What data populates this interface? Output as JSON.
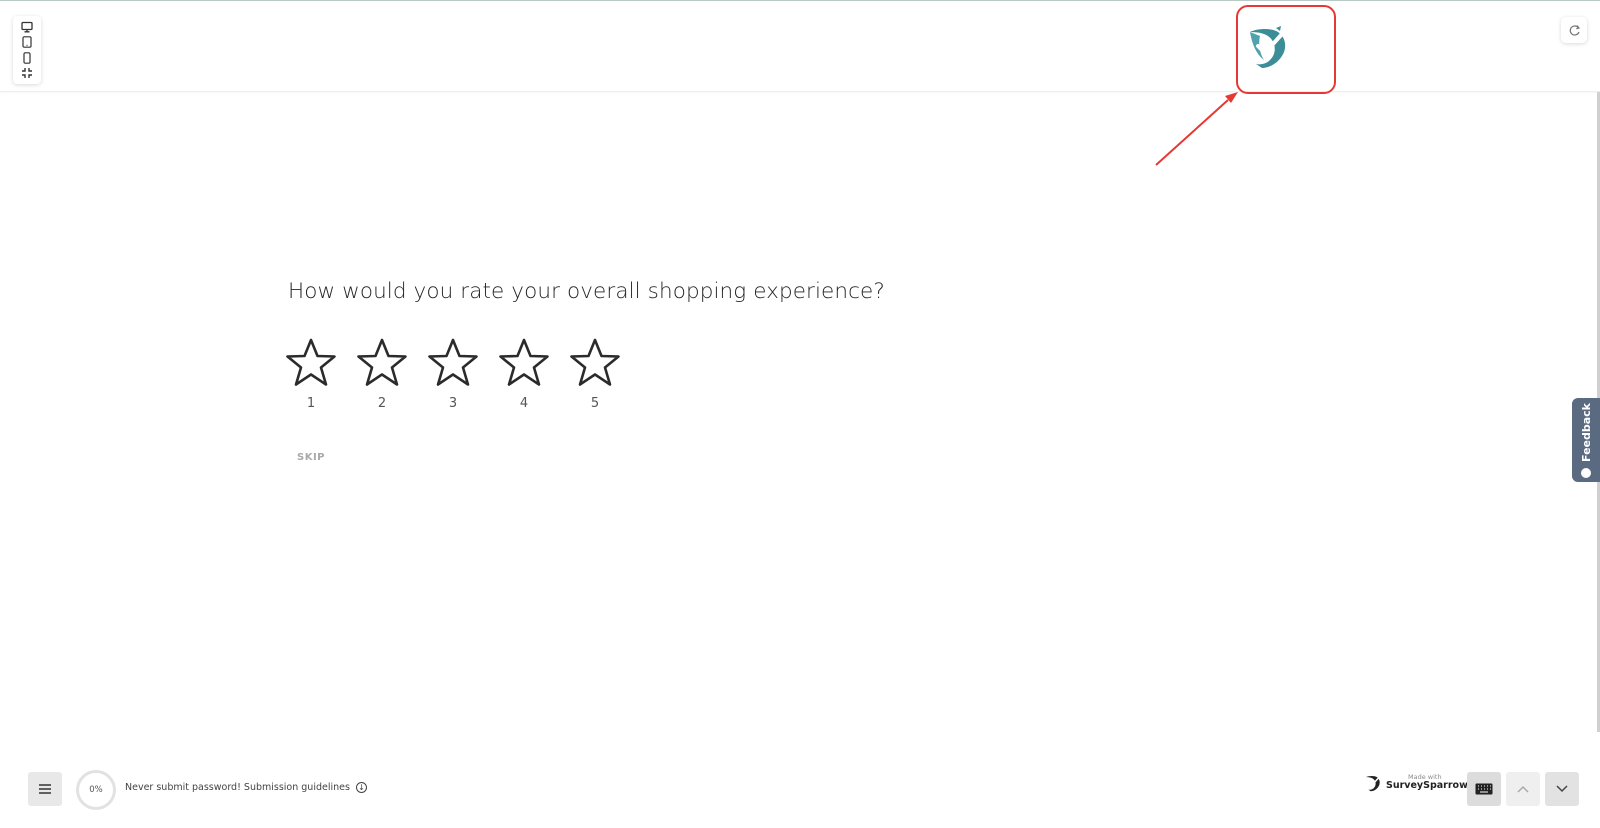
{
  "survey": {
    "question": "How would you rate your overall shopping experience?",
    "rating_labels": [
      "1",
      "2",
      "3",
      "4",
      "5"
    ],
    "skip_label": "SKIP"
  },
  "feedback": {
    "label": "Feedback"
  },
  "footer": {
    "progress": "0%",
    "notice": "Never submit password! Submission guidelines",
    "made_with_small": "Made with",
    "made_with_brand": "SurveySparrow"
  },
  "colors": {
    "brand_teal": "#3b8d98",
    "annotation_red": "#e53935",
    "feedback_tab": "#5a6a80"
  },
  "icons": {
    "logo": "survey-sparrow-logo-icon",
    "desktop": "desktop-icon",
    "tablet": "tablet-icon",
    "mobile": "mobile-icon",
    "collapse": "collapse-icon",
    "refresh": "refresh-icon",
    "star": "star-outline-icon",
    "menu": "hamburger-menu-icon",
    "keyboard": "keyboard-icon",
    "up": "chevron-up-icon",
    "down": "chevron-down-icon"
  }
}
